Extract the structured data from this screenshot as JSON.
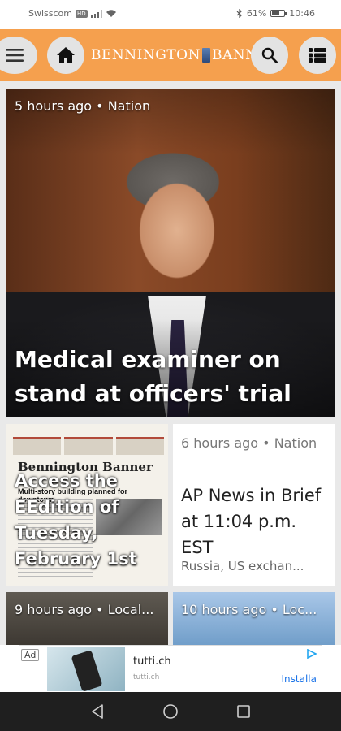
{
  "status_bar": {
    "carrier": "Swisscom",
    "network_badge": "HD",
    "battery": "61%",
    "time": "10:46"
  },
  "header": {
    "logo_left": "BENNINGTON",
    "logo_right": "BANNER"
  },
  "hero": {
    "meta": "5 hours ago • Nation",
    "title": "Medical examiner on stand at officers' trial in..."
  },
  "edition_card": {
    "title": "Access the EEdition of Tuesday, February  1st",
    "paper_masthead": "Bennington Banner",
    "paper_headline": "Multi-story building planned for downtown"
  },
  "brief_card": {
    "meta": "6 hours ago • Nation",
    "title": "AP News in Brief at 11:04 p.m. EST",
    "subtitle": "Russia, US exchan..."
  },
  "tiles": [
    {
      "meta": "9 hours ago • Local..."
    },
    {
      "meta": "10 hours ago • Loc..."
    }
  ],
  "ad": {
    "label": "Ad",
    "title": "tutti.ch",
    "subtitle": "tutti.ch",
    "install": "Installa"
  },
  "colors": {
    "header": "#f5a04e",
    "nav_bar": "#1f1f1f"
  }
}
